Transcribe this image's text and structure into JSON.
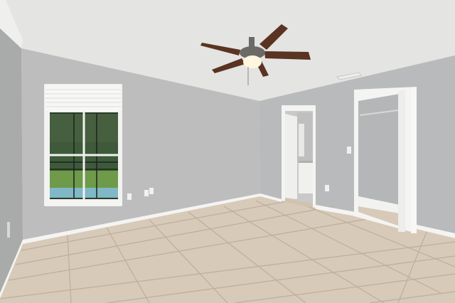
{
  "scene": {
    "kind": "empty-bedroom-interior",
    "features": [
      "ceiling-fan",
      "window-with-blinds",
      "open-doorway",
      "walk-in-closet",
      "tile-floor"
    ]
  },
  "colors": {
    "ceiling": "#e4e4e2",
    "wall_left": "#a9aaaa",
    "wall_back": "#bdbdbe",
    "wall_right": "#b9babb",
    "floor": "#d8cab8",
    "grout": "#bcae9c",
    "trim": "#f4f4f2",
    "fan_blade": "#5a3322",
    "fan_metal": "#6c6a66",
    "light": "#fff6e0",
    "window_glass": "#2b3b2c",
    "lawn": "#6e9a49",
    "pool": "#7fb8c6",
    "closet_wall": "#b5b6b8"
  }
}
